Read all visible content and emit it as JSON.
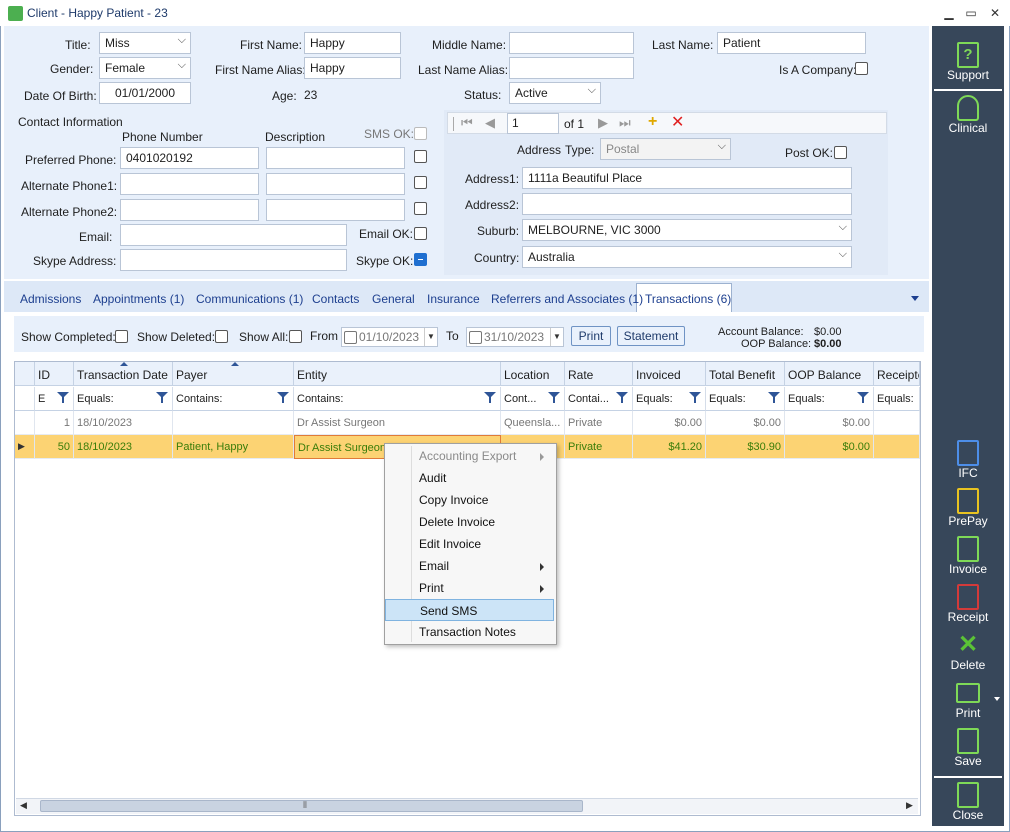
{
  "window": {
    "title": "Client - Happy Patient - 23",
    "min": "▁",
    "max": "▭",
    "close": "✕"
  },
  "form": {
    "title_label": "Title:",
    "title_value": "Miss",
    "first_name_label": "First Name:",
    "first_name_value": "Happy",
    "middle_name_label": "Middle Name:",
    "middle_name_value": "",
    "last_name_label": "Last Name:",
    "last_name_value": "Patient",
    "gender_label": "Gender:",
    "gender_value": "Female",
    "first_alias_label": "First Name Alias:",
    "first_alias_value": "Happy",
    "last_alias_label": "Last Name Alias:",
    "last_alias_value": "",
    "is_company_label": "Is A Company:",
    "dob_label": "Date Of Birth:",
    "dob_value": "01/01/2000",
    "age_label": "Age:",
    "age_value": "23",
    "status_label": "Status:",
    "status_value": "Active"
  },
  "contact": {
    "heading": "Contact Information",
    "phone_number_header": "Phone Number",
    "description_header": "Description",
    "sms_ok_header": "SMS OK:",
    "preferred_label": "Preferred Phone:",
    "preferred_value": "0401020192",
    "alt1_label": "Alternate Phone1:",
    "alt2_label": "Alternate Phone2:",
    "email_label": "Email:",
    "email_ok_label": "Email OK:",
    "skype_label": "Skype Address:",
    "skype_ok_label": "Skype OK:"
  },
  "address": {
    "nav_current": "1",
    "nav_of": "of 1",
    "address_label": "Address",
    "type_label": "Type:",
    "type_value": "Postal",
    "post_ok_label": "Post OK:",
    "address1_label": "Address1:",
    "address1_value": "1111a Beautiful Place",
    "address2_label": "Address2:",
    "address2_value": "",
    "suburb_label": "Suburb:",
    "suburb_value": "MELBOURNE, VIC 3000",
    "country_label": "Country:",
    "country_value": "Australia"
  },
  "tabs": [
    "Admissions",
    "Appointments (1)",
    "Communications (1)",
    "Contacts",
    "General",
    "Insurance",
    "Referrers and Associates (1)",
    "Transactions (6)"
  ],
  "filters": {
    "show_completed": "Show Completed:",
    "show_deleted": "Show Deleted:",
    "show_all": "Show All:",
    "from_label": "From",
    "from_value": "01/10/2023",
    "to_label": "To",
    "to_value": "31/10/2023",
    "print_btn": "Print",
    "statement_btn": "Statement",
    "account_balance_label": "Account Balance:",
    "account_balance_value": "$0.00",
    "oop_balance_label": "OOP Balance:",
    "oop_balance_value": "$0.00"
  },
  "grid": {
    "headers": [
      "ID",
      "Transaction Date",
      "Payer",
      "Entity",
      "Location",
      "Rate",
      "Invoiced",
      "Total Benefit",
      "OOP Balance",
      "Receipte"
    ],
    "filters": [
      "E",
      "Equals:",
      "Contains:",
      "Contains:",
      "Cont...",
      "Contai...",
      "Equals:",
      "Equals:",
      "Equals:",
      "Equals:"
    ],
    "rows": [
      {
        "id": "1",
        "date": "18/10/2023",
        "payer": "",
        "entity": "Dr Assist Surgeon",
        "location": "Queensla...",
        "rate": "Private",
        "invoiced": "$0.00",
        "benefit": "$0.00",
        "oop": "$0.00"
      },
      {
        "id": "50",
        "date": "18/10/2023",
        "payer": "Patient, Happy",
        "entity": "Dr Assist Surgeon",
        "location": "",
        "rate": "Private",
        "invoiced": "$41.20",
        "benefit": "$30.90",
        "oop": "$0.00"
      }
    ]
  },
  "context_menu": [
    "Accounting Export",
    "Audit",
    "Copy Invoice",
    "Delete Invoice",
    "Edit Invoice",
    "Email",
    "Print",
    "Send SMS",
    "Transaction Notes"
  ],
  "sidebar": {
    "support": "Support",
    "clinical": "Clinical",
    "ifc": "IFC",
    "prepay": "PrePay",
    "invoice": "Invoice",
    "receipt": "Receipt",
    "delete": "Delete",
    "print": "Print",
    "save": "Save",
    "close": "Close"
  },
  "colors": {
    "accent": "#1f6fd0",
    "sidebar": "#37475a",
    "selected_row": "#fcd373",
    "green_text": "#3a7d0a"
  }
}
